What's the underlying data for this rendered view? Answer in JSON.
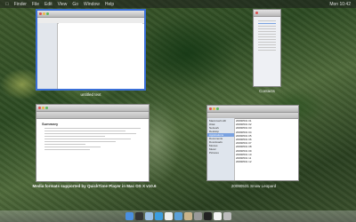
{
  "menubar": {
    "items": [
      "Finder",
      "File",
      "Edit",
      "View",
      "Go",
      "Window",
      "Help"
    ],
    "clock": "Mon 10:42"
  },
  "windows": {
    "textedit": {
      "caption": "untitled text"
    },
    "contacts": {
      "caption": "Contacts"
    },
    "safari": {
      "caption": "Media formats supported by QuickTime Player in Mac OS X v10.6"
    },
    "finder": {
      "caption": "20090531 Snow Leopard"
    }
  },
  "finder": {
    "sidebar": [
      "Macintosh HD",
      "iDisk",
      "Network",
      "Desktop",
      "Applications",
      "Documents",
      "Downloads",
      "Movies",
      "Music",
      "Pictures"
    ],
    "files": [
      "20090531 01",
      "20090531 02",
      "20090531 03",
      "20090531 04",
      "20090531 05",
      "20090531 06",
      "20090531 07",
      "20090531 08",
      "20090531 09",
      "20090531 10",
      "20090531 11",
      "20090531 12"
    ]
  },
  "safari": {
    "heading": "Summary",
    "subheading": "Media formats supported by QuickTime Player"
  },
  "dock": {
    "icons": [
      "finder-icon",
      "dashboard-icon",
      "mail-icon",
      "safari-icon",
      "ical-icon",
      "itunes-icon",
      "preview-icon",
      "system-preferences-icon",
      "terminal-icon",
      "textedit-icon",
      "trash-icon"
    ]
  },
  "colors": {
    "selection": "#3a6fd8"
  }
}
